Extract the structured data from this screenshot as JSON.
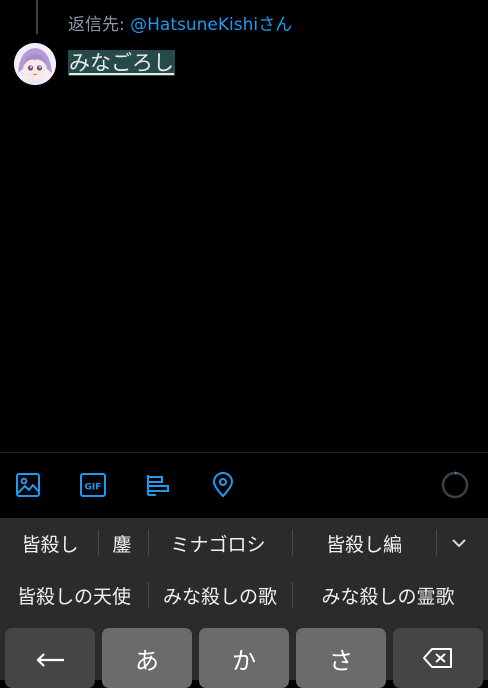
{
  "reply": {
    "prefix": "返信先: ",
    "handle": "@HatsuneKishi",
    "suffix": "さん"
  },
  "compose": {
    "text": "みなごろし"
  },
  "toolbar": {
    "icons": [
      "image-icon",
      "gif-icon",
      "poll-icon",
      "location-icon"
    ],
    "gif_label": "GIF"
  },
  "candidates": {
    "row1": [
      "皆殺し",
      "鏖",
      "ミナゴロシ",
      "皆殺し編"
    ],
    "row2": [
      "皆殺しの天使",
      "みな殺しの歌",
      "みな殺しの霊歌"
    ]
  },
  "keys": {
    "kana": [
      "あ",
      "か",
      "さ"
    ]
  },
  "colors": {
    "accent": "#1d9bf0",
    "highlight": "#264a4a",
    "keyboard_bg": "#2b2b2d",
    "key_bg": "#6b6b6e"
  }
}
